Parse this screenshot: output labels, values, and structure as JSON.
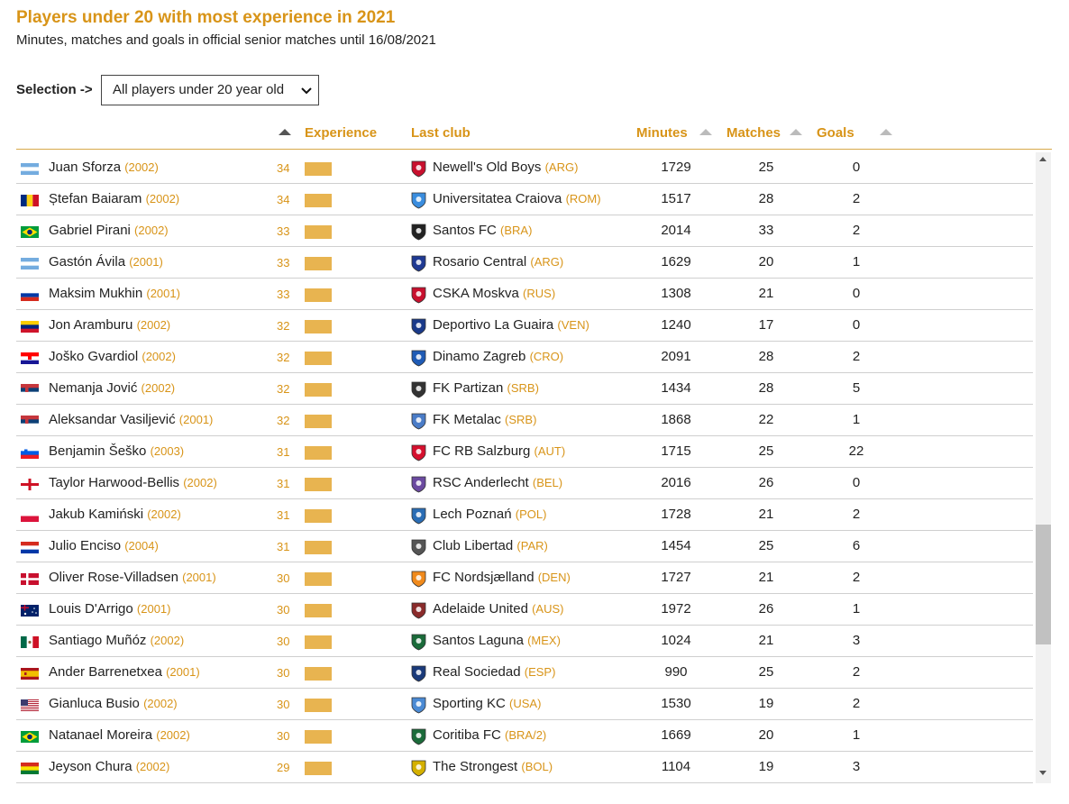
{
  "title": "Players under 20 with most experience in 2021",
  "subtitle": "Minutes, matches and goals in official senior matches until 16/08/2021",
  "selection": {
    "label": "Selection ->",
    "value": "All players under 20 year old"
  },
  "columns": {
    "experience": "Experience",
    "last_club": "Last club",
    "minutes": "Minutes",
    "matches": "Matches",
    "goals": "Goals"
  },
  "bar_color": "#e8b450",
  "accent_color": "#d89418",
  "rows": [
    {
      "name": "Juan Sforza",
      "year": "(2002)",
      "flag": "ARG",
      "exp": "34",
      "club": "Newell's Old Boys",
      "country": "(ARG)",
      "minutes": "1729",
      "matches": "25",
      "goals": "0"
    },
    {
      "name": "Ștefan Baiaram",
      "year": "(2002)",
      "flag": "ROM",
      "exp": "34",
      "club": "Universitatea Craiova",
      "country": "(ROM)",
      "minutes": "1517",
      "matches": "28",
      "goals": "2"
    },
    {
      "name": "Gabriel Pirani",
      "year": "(2002)",
      "flag": "BRA",
      "exp": "33",
      "club": "Santos FC",
      "country": "(BRA)",
      "minutes": "2014",
      "matches": "33",
      "goals": "2"
    },
    {
      "name": "Gastón Ávila",
      "year": "(2001)",
      "flag": "ARG",
      "exp": "33",
      "club": "Rosario Central",
      "country": "(ARG)",
      "minutes": "1629",
      "matches": "20",
      "goals": "1"
    },
    {
      "name": "Maksim Mukhin",
      "year": "(2001)",
      "flag": "RUS",
      "exp": "33",
      "club": "CSKA Moskva",
      "country": "(RUS)",
      "minutes": "1308",
      "matches": "21",
      "goals": "0"
    },
    {
      "name": "Jon Aramburu",
      "year": "(2002)",
      "flag": "VEN",
      "exp": "32",
      "club": "Deportivo La Guaira",
      "country": "(VEN)",
      "minutes": "1240",
      "matches": "17",
      "goals": "0"
    },
    {
      "name": "Joško Gvardiol",
      "year": "(2002)",
      "flag": "CRO",
      "exp": "32",
      "club": "Dinamo Zagreb",
      "country": "(CRO)",
      "minutes": "2091",
      "matches": "28",
      "goals": "2"
    },
    {
      "name": "Nemanja Jović",
      "year": "(2002)",
      "flag": "SRB",
      "exp": "32",
      "club": "FK Partizan",
      "country": "(SRB)",
      "minutes": "1434",
      "matches": "28",
      "goals": "5"
    },
    {
      "name": "Aleksandar Vasiljević",
      "year": "(2001)",
      "flag": "SRB",
      "exp": "32",
      "club": "FK Metalac",
      "country": "(SRB)",
      "minutes": "1868",
      "matches": "22",
      "goals": "1"
    },
    {
      "name": "Benjamin Šeško",
      "year": "(2003)",
      "flag": "SVN",
      "exp": "31",
      "club": "FC RB Salzburg",
      "country": "(AUT)",
      "minutes": "1715",
      "matches": "25",
      "goals": "22"
    },
    {
      "name": "Taylor Harwood-Bellis",
      "year": "(2002)",
      "flag": "ENG",
      "exp": "31",
      "club": "RSC Anderlecht",
      "country": "(BEL)",
      "minutes": "2016",
      "matches": "26",
      "goals": "0"
    },
    {
      "name": "Jakub Kamiński",
      "year": "(2002)",
      "flag": "POL",
      "exp": "31",
      "club": "Lech Poznań",
      "country": "(POL)",
      "minutes": "1728",
      "matches": "21",
      "goals": "2"
    },
    {
      "name": "Julio Enciso",
      "year": "(2004)",
      "flag": "PAR",
      "exp": "31",
      "club": "Club Libertad",
      "country": "(PAR)",
      "minutes": "1454",
      "matches": "25",
      "goals": "6"
    },
    {
      "name": "Oliver Rose-Villadsen",
      "year": "(2001)",
      "flag": "DEN",
      "exp": "30",
      "club": "FC Nordsjælland",
      "country": "(DEN)",
      "minutes": "1727",
      "matches": "21",
      "goals": "2"
    },
    {
      "name": "Louis D'Arrigo",
      "year": "(2001)",
      "flag": "AUS",
      "exp": "30",
      "club": "Adelaide United",
      "country": "(AUS)",
      "minutes": "1972",
      "matches": "26",
      "goals": "1"
    },
    {
      "name": "Santiago Muñóz",
      "year": "(2002)",
      "flag": "MEX",
      "exp": "30",
      "club": "Santos Laguna",
      "country": "(MEX)",
      "minutes": "1024",
      "matches": "21",
      "goals": "3"
    },
    {
      "name": "Ander Barrenetxea",
      "year": "(2001)",
      "flag": "ESP",
      "exp": "30",
      "club": "Real Sociedad",
      "country": "(ESP)",
      "minutes": "990",
      "matches": "25",
      "goals": "2"
    },
    {
      "name": "Gianluca Busio",
      "year": "(2002)",
      "flag": "USA",
      "exp": "30",
      "club": "Sporting KC",
      "country": "(USA)",
      "minutes": "1530",
      "matches": "19",
      "goals": "2"
    },
    {
      "name": "Natanael Moreira",
      "year": "(2002)",
      "flag": "BRA",
      "exp": "30",
      "club": "Coritiba FC",
      "country": "(BRA/2)",
      "minutes": "1669",
      "matches": "20",
      "goals": "1"
    },
    {
      "name": "Jeyson Chura",
      "year": "(2002)",
      "flag": "BOL",
      "exp": "29",
      "club": "The Strongest",
      "country": "(BOL)",
      "minutes": "1104",
      "matches": "19",
      "goals": "3"
    }
  ]
}
